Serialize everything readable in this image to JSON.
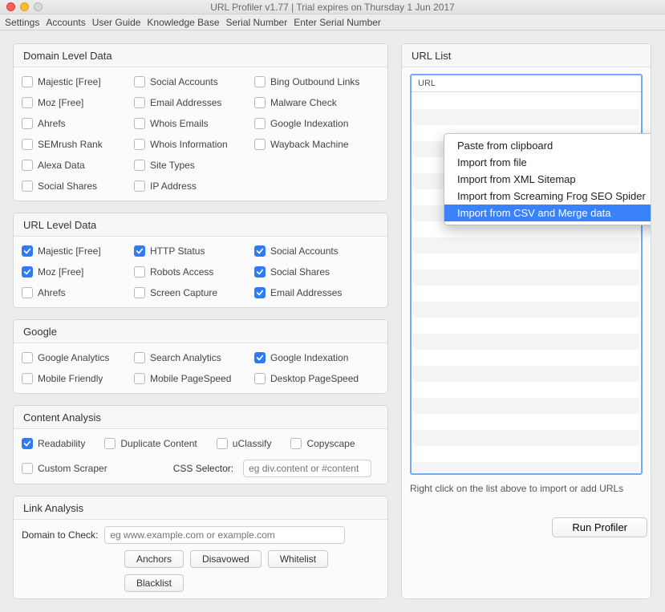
{
  "window": {
    "title": "URL Profiler v1.77 | Trial expires on Thursday 1 Jun 2017"
  },
  "menubar": [
    "Settings",
    "Accounts",
    "User Guide",
    "Knowledge Base",
    "Serial Number",
    "Enter Serial Number"
  ],
  "panels": {
    "domain": {
      "title": "Domain Level Data",
      "items": [
        {
          "label": "Majestic [Free]",
          "checked": false
        },
        {
          "label": "Social Accounts",
          "checked": false
        },
        {
          "label": "Bing Outbound Links",
          "checked": false
        },
        {
          "label": "Moz [Free]",
          "checked": false
        },
        {
          "label": "Email Addresses",
          "checked": false
        },
        {
          "label": "Malware Check",
          "checked": false
        },
        {
          "label": "Ahrefs",
          "checked": false
        },
        {
          "label": "Whois Emails",
          "checked": false
        },
        {
          "label": "Google Indexation",
          "checked": false
        },
        {
          "label": "SEMrush Rank",
          "checked": false
        },
        {
          "label": "Whois Information",
          "checked": false
        },
        {
          "label": "Wayback Machine",
          "checked": false
        },
        {
          "label": "Alexa Data",
          "checked": false
        },
        {
          "label": "Site Types",
          "checked": false
        },
        {
          "label": "",
          "checked": false,
          "empty": true
        },
        {
          "label": "Social Shares",
          "checked": false
        },
        {
          "label": "IP Address",
          "checked": false
        }
      ]
    },
    "url": {
      "title": "URL Level Data",
      "items": [
        {
          "label": "Majestic [Free]",
          "checked": true
        },
        {
          "label": "HTTP Status",
          "checked": true
        },
        {
          "label": "Social Accounts",
          "checked": true
        },
        {
          "label": "Moz [Free]",
          "checked": true
        },
        {
          "label": "Robots Access",
          "checked": false
        },
        {
          "label": "Social Shares",
          "checked": true
        },
        {
          "label": "Ahrefs",
          "checked": false
        },
        {
          "label": "Screen Capture",
          "checked": false
        },
        {
          "label": "Email Addresses",
          "checked": true
        }
      ]
    },
    "google": {
      "title": "Google",
      "items": [
        {
          "label": "Google Analytics",
          "checked": false
        },
        {
          "label": "Search Analytics",
          "checked": false
        },
        {
          "label": "Google Indexation",
          "checked": true
        },
        {
          "label": "Mobile Friendly",
          "checked": false
        },
        {
          "label": "Mobile PageSpeed",
          "checked": false
        },
        {
          "label": "Desktop PageSpeed",
          "checked": false
        }
      ]
    },
    "content": {
      "title": "Content Analysis",
      "row1": [
        {
          "label": "Readability",
          "checked": true
        },
        {
          "label": "Duplicate Content",
          "checked": false
        },
        {
          "label": "uClassify",
          "checked": false
        },
        {
          "label": "Copyscape",
          "checked": false
        }
      ],
      "row2": {
        "custom": {
          "label": "Custom Scraper",
          "checked": false
        },
        "css_label": "CSS Selector:",
        "css_placeholder": "eg div.content or #content"
      }
    },
    "link": {
      "title": "Link Analysis",
      "domain_label": "Domain to Check:",
      "domain_placeholder": "eg www.example.com or example.com",
      "buttons": [
        "Anchors",
        "Disavowed",
        "Whitelist",
        "Blacklist"
      ]
    }
  },
  "urlList": {
    "title": "URL List",
    "column": "URL",
    "hint": "Right click on the list above to import or add URLs",
    "context_menu": [
      {
        "label": "Paste from clipboard",
        "selected": false
      },
      {
        "label": "Import from file",
        "selected": false
      },
      {
        "label": "Import from XML Sitemap",
        "selected": false
      },
      {
        "label": "Import from Screaming Frog SEO Spider",
        "selected": false
      },
      {
        "label": "Import from CSV and Merge data",
        "selected": true
      }
    ]
  },
  "run_button": "Run Profiler"
}
